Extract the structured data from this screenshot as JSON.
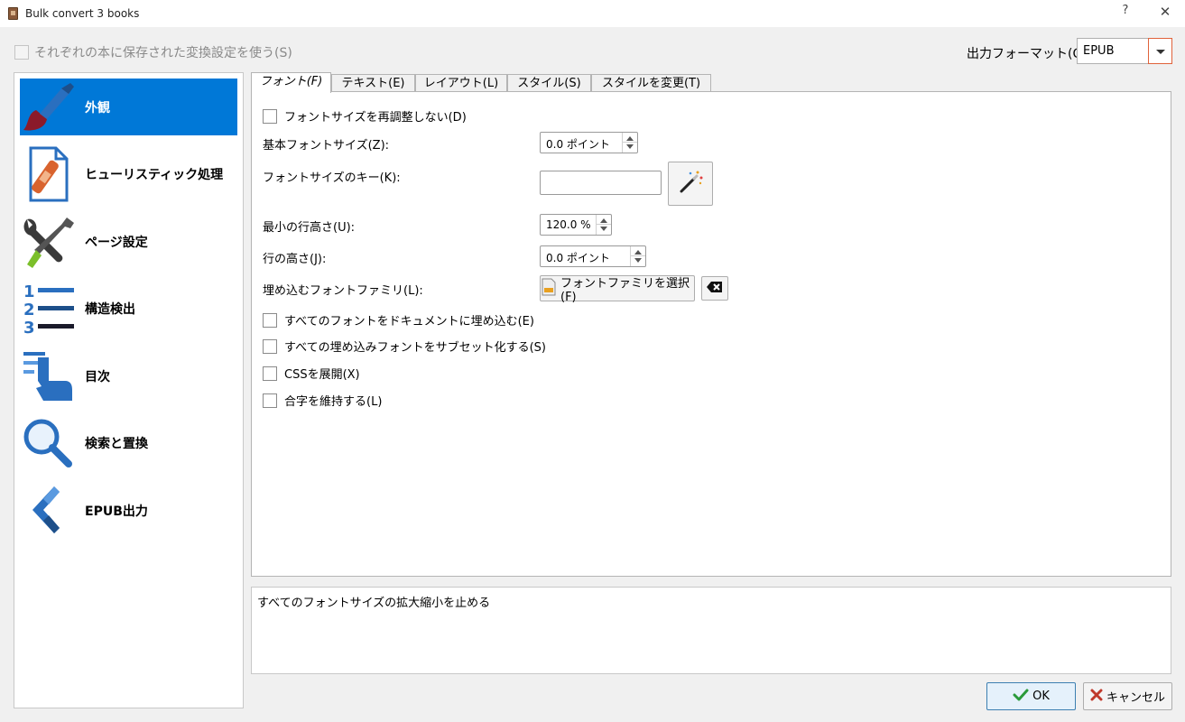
{
  "window": {
    "title": "Bulk convert 3 books",
    "help": "?",
    "close": "✕"
  },
  "global": {
    "use_saved_settings_label": "それぞれの本に保存された変換設定を使う(S)"
  },
  "output_format": {
    "label": "出力フォーマット(O):",
    "value": "EPUB"
  },
  "sidebar": {
    "items": [
      {
        "label": "外観"
      },
      {
        "label": "ヒューリスティック処理"
      },
      {
        "label": "ページ設定"
      },
      {
        "label": "構造検出"
      },
      {
        "label": "目次"
      },
      {
        "label": "検索と置換"
      },
      {
        "label": "EPUB出力"
      }
    ]
  },
  "tabs": [
    {
      "label": "フォント(F)"
    },
    {
      "label": "テキスト(E)"
    },
    {
      "label": "レイアウト(L)"
    },
    {
      "label": "スタイル(S)"
    },
    {
      "label": "スタイルを変更(T)"
    }
  ],
  "font_tab": {
    "dont_rescale_label": "フォントサイズを再調整しない(D)",
    "base_font_size_label": "基本フォントサイズ(Z):",
    "base_font_size_value": "0.0 ポイント",
    "font_size_key_label": "フォントサイズのキー(K):",
    "font_size_key_value": "",
    "min_line_height_label": "最小の行高さ(U):",
    "min_line_height_value": "120.0 %",
    "line_height_label": "行の高さ(J):",
    "line_height_value": "0.0 ポイント",
    "embed_font_family_label": "埋め込むフォントファミリ(L):",
    "choose_font_family_button": "フォントファミリを選択(F)",
    "embed_all_fonts_label": "すべてのフォントをドキュメントに埋め込む(E)",
    "subset_fonts_label": "すべての埋め込みフォントをサブセット化する(S)",
    "expand_css_label": "CSSを展開(X)",
    "keep_ligatures_label": "合字を維持する(L)"
  },
  "description": {
    "text": "すべてのフォントサイズの拡大縮小を止める"
  },
  "buttons": {
    "ok": "OK",
    "cancel": "キャンセル"
  },
  "colors": {
    "accent": "#0078d7",
    "active_border": "#e0623a"
  }
}
